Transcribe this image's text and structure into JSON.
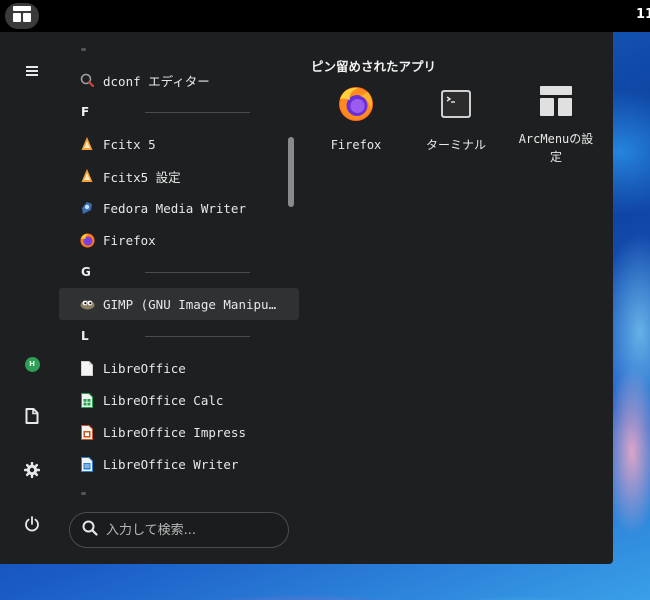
{
  "panel": {
    "menu_button_icon": "arcmenu-icon",
    "clock": "11"
  },
  "sidebar": {
    "buttons": [
      {
        "name": "hamburger-menu-icon"
      },
      {
        "name": "user-avatar",
        "initial": "H",
        "color": "#2e9e58"
      },
      {
        "name": "document-icon"
      },
      {
        "name": "gear-icon"
      },
      {
        "name": "power-icon"
      }
    ]
  },
  "app_list": {
    "entries": [
      {
        "type": "app",
        "label": "dconf エディター",
        "icon": "dconf-editor-icon"
      },
      {
        "type": "section",
        "label": "F"
      },
      {
        "type": "app",
        "label": "Fcitx 5",
        "icon": "fcitx-icon"
      },
      {
        "type": "app",
        "label": "Fcitx5 設定",
        "icon": "fcitx-config-icon"
      },
      {
        "type": "app",
        "label": "Fedora Media Writer",
        "icon": "fedora-media-writer-icon"
      },
      {
        "type": "app",
        "label": "Firefox",
        "icon": "firefox-icon"
      },
      {
        "type": "section",
        "label": "G"
      },
      {
        "type": "app",
        "label": "GIMP (GNU Image Manipu…",
        "icon": "gimp-icon",
        "highlighted": true
      },
      {
        "type": "section",
        "label": "L"
      },
      {
        "type": "app",
        "label": "LibreOffice",
        "icon": "libreoffice-icon"
      },
      {
        "type": "app",
        "label": "LibreOffice Calc",
        "icon": "libreoffice-calc-icon"
      },
      {
        "type": "app",
        "label": "LibreOffice Impress",
        "icon": "libreoffice-impress-icon"
      },
      {
        "type": "app",
        "label": "LibreOffice Writer",
        "icon": "libreoffice-writer-icon"
      }
    ]
  },
  "search": {
    "placeholder": "入力して検索..."
  },
  "pinned": {
    "title": "ピン留めされたアプリ",
    "apps": [
      {
        "label": "Firefox",
        "icon": "firefox-icon"
      },
      {
        "label": "ターミナル",
        "icon": "terminal-icon"
      },
      {
        "label": "ArcMenuの設定",
        "icon": "arcmenu-settings-icon"
      }
    ]
  },
  "colors": {
    "menu_bg": "#1e1f20",
    "highlight": "#2f3133",
    "panel_bg": "#000000"
  }
}
